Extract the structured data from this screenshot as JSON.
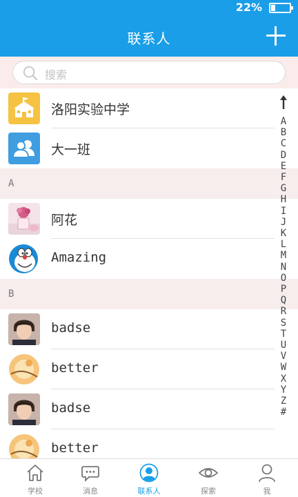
{
  "status_bar": {
    "battery_text": "22%",
    "battery_level": 0.22
  },
  "header": {
    "title": "联系人",
    "add_icon": "plus-icon"
  },
  "search": {
    "placeholder": "搜索"
  },
  "groups": [
    {
      "name": "洛阳实验中学",
      "icon": "school-icon",
      "color": "#f5c242"
    },
    {
      "name": "大一班",
      "icon": "people-icon",
      "color": "#3f9de0"
    }
  ],
  "sections": [
    {
      "letter": "A",
      "contacts": [
        {
          "name": "阿花",
          "avatar": "flower-photo"
        },
        {
          "name": "Amazing",
          "avatar": "doraemon"
        }
      ]
    },
    {
      "letter": "B",
      "contacts": [
        {
          "name": "badse",
          "avatar": "boy-photo"
        },
        {
          "name": "better",
          "avatar": "moon-photo"
        },
        {
          "name": "badse",
          "avatar": "boy-photo"
        },
        {
          "name": "better",
          "avatar": "moon-photo"
        }
      ]
    }
  ],
  "index_bar": {
    "arrow": "up-arrow-icon",
    "letters": [
      "A",
      "B",
      "C",
      "D",
      "E",
      "F",
      "G",
      "H",
      "I",
      "J",
      "K",
      "L",
      "M",
      "N",
      "O",
      "P",
      "Q",
      "R",
      "S",
      "T",
      "U",
      "V",
      "W",
      "X",
      "Y",
      "Z",
      "#"
    ]
  },
  "tabbar": {
    "active_color": "#1a9ee8",
    "tabs": [
      {
        "label": "学校",
        "icon": "home-icon"
      },
      {
        "label": "消息",
        "icon": "chat-icon"
      },
      {
        "label": "联系人",
        "icon": "contact-icon",
        "active": true
      },
      {
        "label": "探索",
        "icon": "eye-icon"
      },
      {
        "label": "我",
        "icon": "user-icon"
      }
    ]
  }
}
